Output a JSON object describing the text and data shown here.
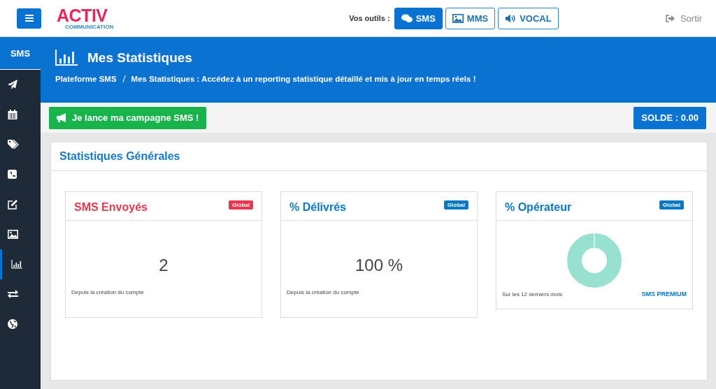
{
  "header": {
    "logo": "ACTIV",
    "logo_sub": "COMMUNICATION",
    "tools_label": "Vos outils :",
    "tools": [
      {
        "kind": "chat",
        "label": "SMS",
        "selected": true
      },
      {
        "kind": "image",
        "label": "MMS",
        "selected": false
      },
      {
        "kind": "volume",
        "label": "VOCAL",
        "selected": false
      }
    ],
    "logout": "Sortir"
  },
  "sidebar": {
    "title": "SMS",
    "items": [
      {
        "kind": "send",
        "selected": false
      },
      {
        "kind": "calendar",
        "selected": false
      },
      {
        "kind": "tags",
        "selected": false
      },
      {
        "kind": "phone",
        "selected": false
      },
      {
        "kind": "edit",
        "selected": false
      },
      {
        "kind": "image",
        "selected": false
      },
      {
        "kind": "chart",
        "selected": true
      },
      {
        "kind": "exchange",
        "selected": false
      },
      {
        "kind": "globe",
        "selected": false
      }
    ]
  },
  "banner": {
    "title": "Mes Statistiques",
    "breadcrumb": [
      "Plateforme SMS",
      "Mes Statistiques : Accédez à un reporting statistique détaillé et mis à jour en temps réels !"
    ]
  },
  "actions": {
    "campaign_button": "Je lance ma campagne SMS !",
    "balance": "SOLDE : 0.00"
  },
  "panel": {
    "title": "Statistiques Générales",
    "cards": [
      {
        "kind": "value",
        "title": "SMS Envoyés",
        "badge": "Global",
        "color": "#e8384f",
        "value": "2",
        "footnote": "Depuis la création du compte"
      },
      {
        "kind": "value",
        "title": "% Délivrés",
        "badge": "Global",
        "color": "#0a78c2",
        "value": "100 %",
        "footnote": "Depuis la création du compte"
      },
      {
        "kind": "donut",
        "title": "% Opérateur",
        "badge": "Global",
        "color": "#0a78c2",
        "footnote": "Sur les 12 derniers mois",
        "legend": "SMS PREMIUM"
      }
    ]
  }
}
